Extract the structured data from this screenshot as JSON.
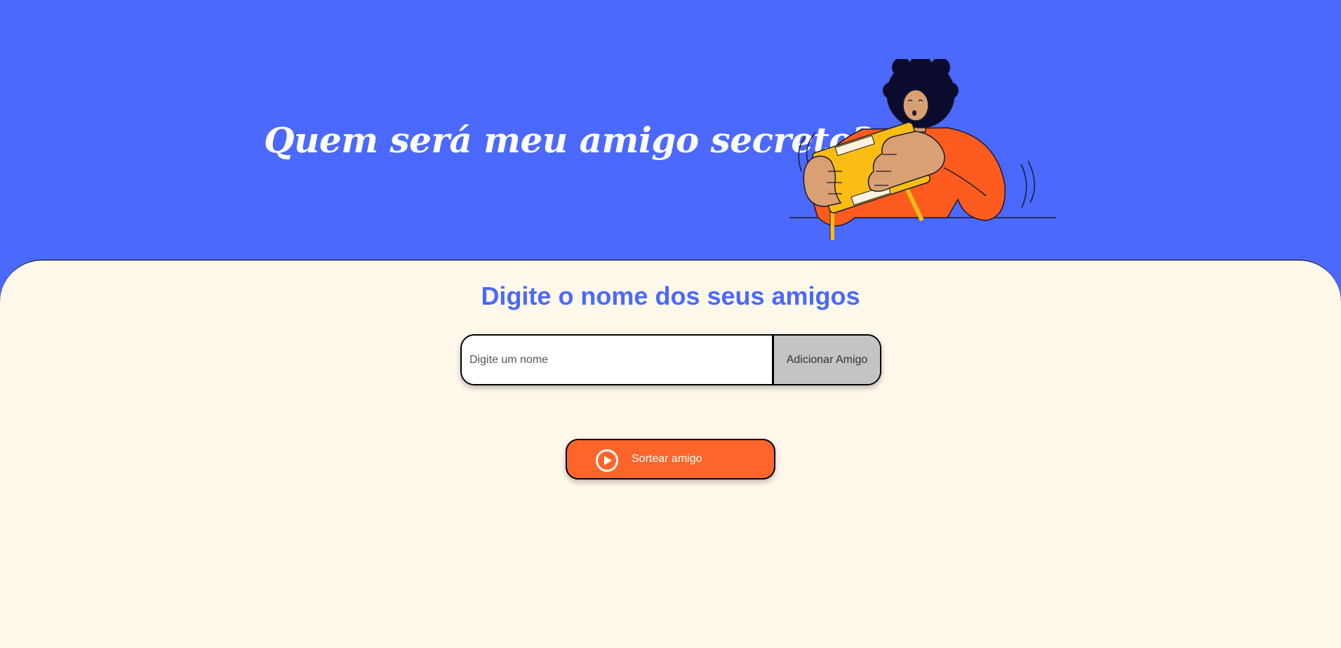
{
  "header": {
    "title": "Quem será meu amigo secreto?",
    "illustration": "person-opening-gift-box-illustration",
    "background_color": "#4B69FD"
  },
  "main": {
    "background_color": "#FFF8EB",
    "section_title": "Digite o nome dos seus amigos",
    "name_input": {
      "placeholder": "Digite um nome",
      "value": ""
    },
    "add_button_label": "Adicionar Amigo",
    "draw_button": {
      "label": "Sortear amigo",
      "icon": "play-circle-icon",
      "color": "#FE652B"
    }
  }
}
